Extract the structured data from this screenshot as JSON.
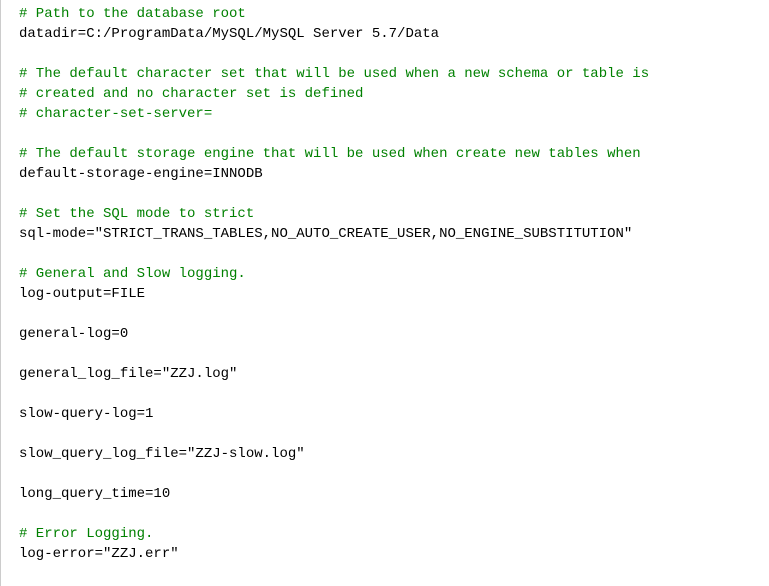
{
  "lines": [
    {
      "type": "comment",
      "text": "# Path to the database root"
    },
    {
      "type": "config",
      "text": "datadir=C:/ProgramData/MySQL/MySQL Server 5.7/Data"
    },
    {
      "type": "blank",
      "text": ""
    },
    {
      "type": "comment",
      "text": "# The default character set that will be used when a new schema or table is"
    },
    {
      "type": "comment",
      "text": "# created and no character set is defined"
    },
    {
      "type": "comment",
      "text": "# character-set-server="
    },
    {
      "type": "blank",
      "text": ""
    },
    {
      "type": "comment",
      "text": "# The default storage engine that will be used when create new tables when"
    },
    {
      "type": "config",
      "text": "default-storage-engine=INNODB"
    },
    {
      "type": "blank",
      "text": ""
    },
    {
      "type": "comment",
      "text": "# Set the SQL mode to strict"
    },
    {
      "type": "config",
      "text": "sql-mode=\"STRICT_TRANS_TABLES,NO_AUTO_CREATE_USER,NO_ENGINE_SUBSTITUTION\""
    },
    {
      "type": "blank",
      "text": ""
    },
    {
      "type": "comment",
      "text": "# General and Slow logging."
    },
    {
      "type": "config",
      "text": "log-output=FILE"
    },
    {
      "type": "blank",
      "text": ""
    },
    {
      "type": "config",
      "text": "general-log=0"
    },
    {
      "type": "blank",
      "text": ""
    },
    {
      "type": "config",
      "text": "general_log_file=\"ZZJ.log\""
    },
    {
      "type": "blank",
      "text": ""
    },
    {
      "type": "config",
      "text": "slow-query-log=1"
    },
    {
      "type": "blank",
      "text": ""
    },
    {
      "type": "config",
      "text": "slow_query_log_file=\"ZZJ-slow.log\""
    },
    {
      "type": "blank",
      "text": ""
    },
    {
      "type": "config",
      "text": "long_query_time=10"
    },
    {
      "type": "blank",
      "text": ""
    },
    {
      "type": "comment",
      "text": "# Error Logging."
    },
    {
      "type": "config",
      "text": "log-error=\"ZZJ.err\""
    }
  ]
}
